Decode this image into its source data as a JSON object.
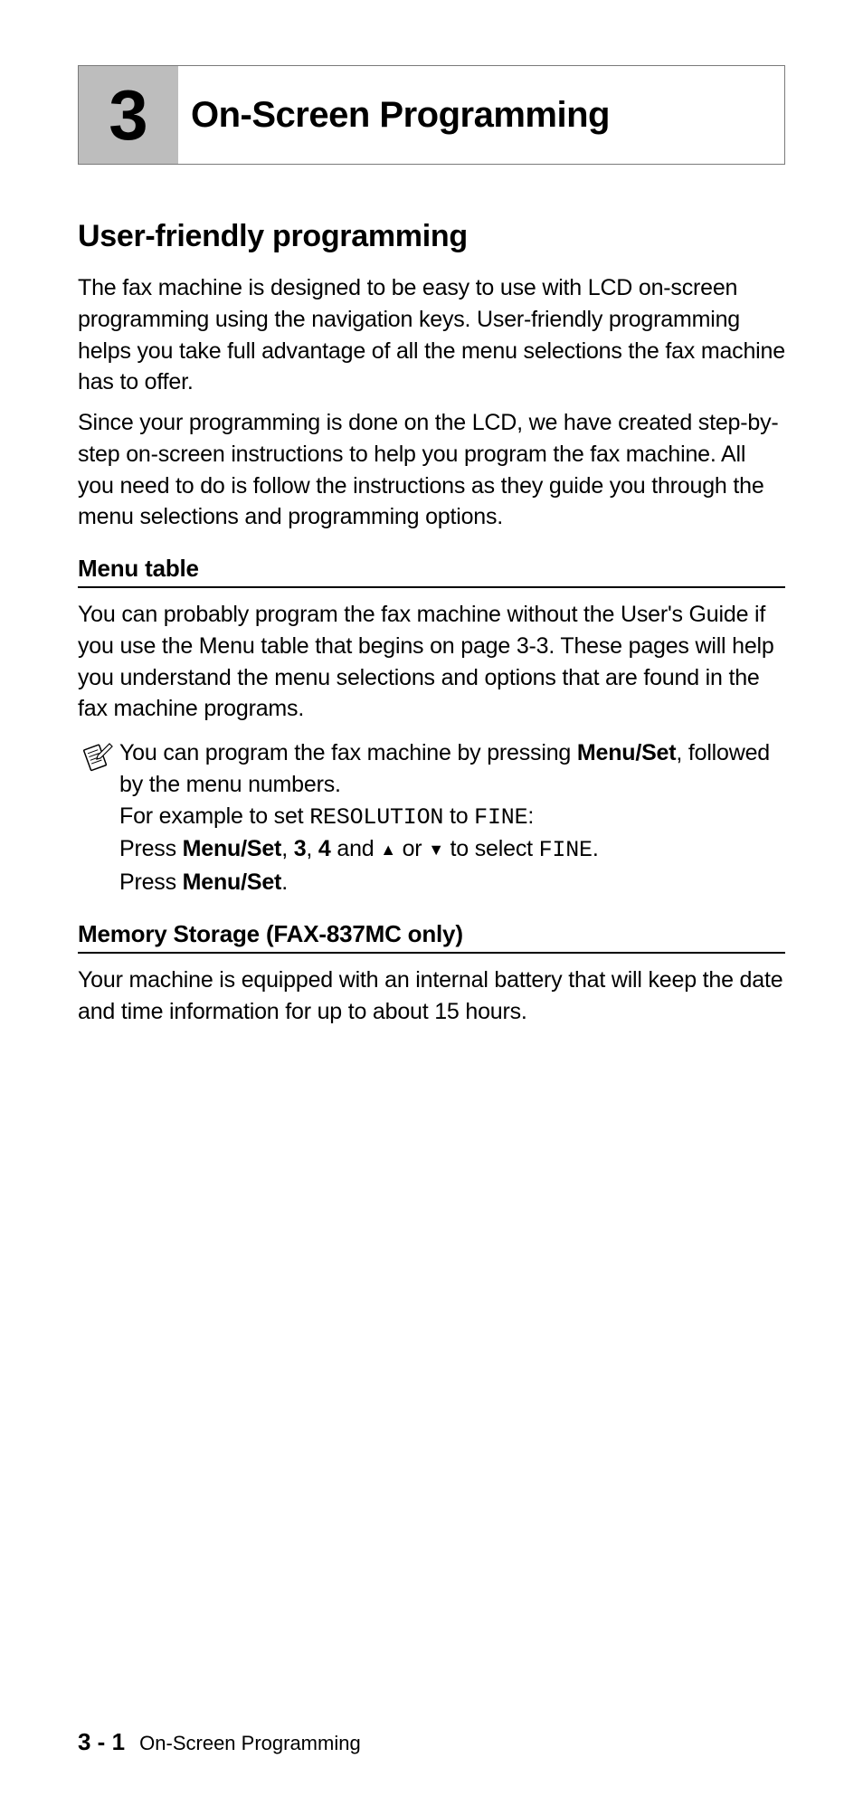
{
  "chapter": {
    "number": "3",
    "title": "On-Screen Programming"
  },
  "section1": {
    "heading": "User-friendly programming",
    "para1": "The fax machine is designed to be easy to use with LCD on-screen programming using the navigation keys. User-friendly programming helps you take full advantage of all the menu selections the fax machine has to offer.",
    "para2": "Since your programming is done on the LCD, we have created step-by-step on-screen instructions to help you program the fax machine. All you need to do is follow the instructions as they guide you through the menu selections and programming options."
  },
  "subsection1": {
    "heading": "Menu table",
    "para": "You can probably program the fax machine without the User's Guide if you use the Menu table that begins on page 3-3. These pages will help you understand the menu selections and options that are found in the fax machine programs.",
    "note": {
      "line1a": "You can program the fax machine by pressing ",
      "line1b": "Menu/Set",
      "line1c": ", followed by the menu numbers.",
      "line2a": "For example to set ",
      "line2b": "RESOLUTION",
      "line2c": " to ",
      "line2d": "FINE",
      "line2e": ":",
      "line3a": "Press ",
      "line3b": "Menu/Set",
      "line3c": ", ",
      "line3d": "3",
      "line3e": ", ",
      "line3f": "4",
      "line3g": " and ",
      "line3h": " or ",
      "line3i": " to select ",
      "line3j": "FINE",
      "line3k": ".",
      "line4a": "Press ",
      "line4b": "Menu/Set",
      "line4c": "."
    }
  },
  "subsection2": {
    "heading": "Memory Storage (FAX-837MC only)",
    "para": "Your machine is equipped with an internal battery that will keep the date and time information for up to about 15 hours."
  },
  "footer": {
    "page_num": "3 - 1",
    "running_title": "On-Screen Programming"
  }
}
